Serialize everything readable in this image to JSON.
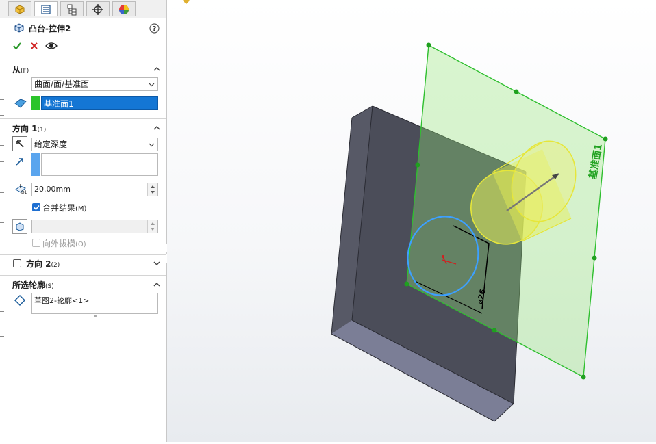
{
  "feature": {
    "title": "凸台-拉伸2",
    "help_icon": "help-icon",
    "ok_icon": "checkmark-icon",
    "cancel_icon": "cross-icon",
    "preview_icon": "eye-icon"
  },
  "tabs": [
    {
      "icon": "feature-manager-icon"
    },
    {
      "icon": "property-manager-icon",
      "active": true
    },
    {
      "icon": "configuration-manager-icon"
    },
    {
      "icon": "dimxpert-icon"
    },
    {
      "icon": "display-manager-icon"
    }
  ],
  "from_section": {
    "title": "从",
    "mnemonic": "(F)",
    "type_value": "曲面/面/基准面",
    "selected_entity": "基准面1"
  },
  "direction1": {
    "title": "方向 1",
    "mnemonic": "(1)",
    "end_condition": "给定深度",
    "depth": "20.00mm",
    "merge_label": "合并结果",
    "merge_mnemonic": "(M)",
    "merge_checked": true,
    "draft_label": "向外拔模",
    "draft_mnemonic": "(O)",
    "draft_checked": false
  },
  "direction2": {
    "title": "方向 2",
    "mnemonic": "(2)",
    "checked": false
  },
  "selected_contours": {
    "title": "所选轮廓",
    "mnemonic": "(S)",
    "item": "草图2-轮廓<1>"
  },
  "viewport": {
    "plane_label": "基准面1",
    "dimension_label": "⌀26",
    "colors": {
      "plane": "#2fbf2f",
      "cylinder": "#e6f03a",
      "circle": "#3da0ff",
      "box": "#4b4d59"
    }
  }
}
